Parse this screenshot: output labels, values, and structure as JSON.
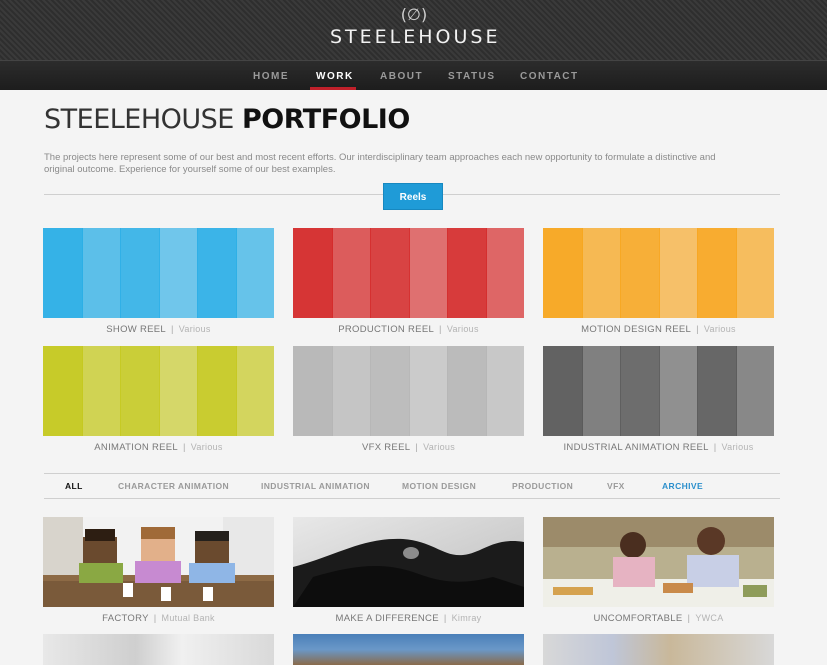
{
  "brand": {
    "name": "STEELEHOUSE",
    "mark": "(∅)"
  },
  "nav": {
    "items": [
      {
        "label": "HOME",
        "active": false
      },
      {
        "label": "WORK",
        "active": true
      },
      {
        "label": "ABOUT",
        "active": false
      },
      {
        "label": "STATUS",
        "active": false
      },
      {
        "label": "CONTACT",
        "active": false
      }
    ]
  },
  "page": {
    "title_light": "STEELEHOUSE",
    "title_bold": "PORTFOLIO",
    "intro": "The projects here represent some of our best and most recent efforts. Our interdisciplinary team approaches each new opportunity to formulate a distinctive and original outcome. Experience for yourself some of our best examples."
  },
  "reels_tab": {
    "label": "Reels"
  },
  "reels": [
    {
      "title": "SHOW REEL",
      "client": "Various",
      "color": "#2aaee6"
    },
    {
      "title": "PRODUCTION REEL",
      "client": "Various",
      "color": "#d42a2a"
    },
    {
      "title": "MOTION DESIGN REEL",
      "client": "Various",
      "color": "#f7a51e"
    },
    {
      "title": "ANIMATION REEL",
      "client": "Various",
      "color": "#c4c81e"
    },
    {
      "title": "VFX REEL",
      "client": "Various",
      "color": "#b5b5b5"
    },
    {
      "title": "INDUSTRIAL ANIMATION REEL",
      "client": "Various",
      "color": "#5a5a5a"
    }
  ],
  "filters": [
    {
      "label": "ALL",
      "state": "active"
    },
    {
      "label": "CHARACTER ANIMATION",
      "state": ""
    },
    {
      "label": "INDUSTRIAL ANIMATION",
      "state": ""
    },
    {
      "label": "MOTION DESIGN",
      "state": ""
    },
    {
      "label": "PRODUCTION",
      "state": ""
    },
    {
      "label": "VFX",
      "state": ""
    },
    {
      "label": "ARCHIVE",
      "state": "highlight"
    }
  ],
  "projects": [
    {
      "title": "FACTORY",
      "client": "Mutual Bank"
    },
    {
      "title": "MAKE A DIFFERENCE",
      "client": "Kimray"
    },
    {
      "title": "UNCOMFORTABLE",
      "client": "YWCA"
    }
  ]
}
